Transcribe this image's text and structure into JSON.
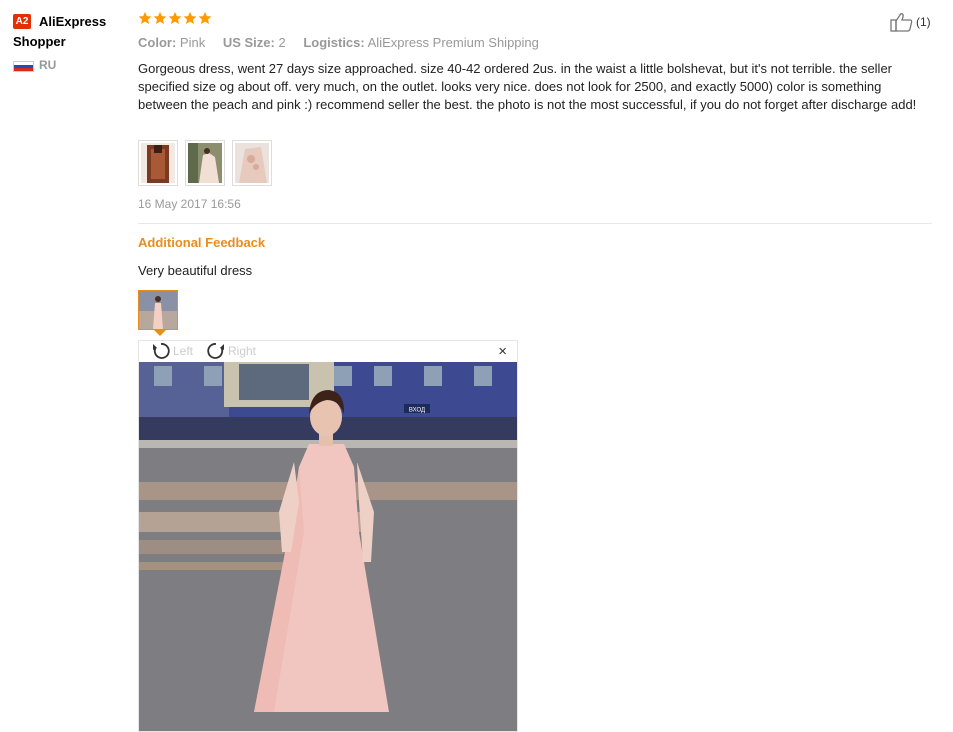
{
  "reviewer": {
    "badge": "A2",
    "name": "AliExpress Shopper",
    "country": "RU"
  },
  "rating": {
    "stars": 5,
    "max": 5
  },
  "meta": {
    "color_label": "Color:",
    "color_value": "Pink",
    "size_label": "US Size:",
    "size_value": "2",
    "logistics_label": "Logistics:",
    "logistics_value": "AliExpress Premium Shipping"
  },
  "like": {
    "count": "(1)"
  },
  "review": {
    "text": "Gorgeous dress, went 27 days size approached. size 40-42 ordered 2us. in the waist a little bolshevat, but it's not terrible. the seller specified size og about off. very much, on the outlet. looks very nice. does not look for 2500, and exactly 5000) color is something between the peach and pink :) recommend seller the best. the photo is not the most successful, if you do not forget after discharge add!",
    "date": "16 May 2017 16:56"
  },
  "additional": {
    "title": "Additional Feedback",
    "text": "Very beautiful dress"
  },
  "viewer": {
    "left_label": "Left",
    "right_label": "Right",
    "close": "×",
    "sign_text": "ВХОД"
  },
  "colors": {
    "accent": "#e98e1a",
    "badge": "#e62e04",
    "star": "#ff9a00"
  }
}
